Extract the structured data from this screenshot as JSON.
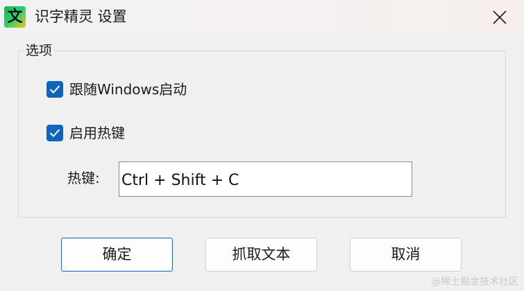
{
  "window": {
    "icon_glyph": "文",
    "title": "识字精灵 设置",
    "icon_colors": [
      "#19b35a",
      "#f3c51b"
    ]
  },
  "options": {
    "group_title": "选项",
    "start_with_windows": {
      "label": "跟随Windows启动",
      "checked": true
    },
    "enable_hotkey": {
      "label": "启用热键",
      "checked": true
    },
    "hotkey_label": "热键:",
    "hotkey_value": "Ctrl + Shift + C"
  },
  "buttons": {
    "ok": "确定",
    "capture": "抓取文本",
    "cancel": "取消"
  },
  "watermark": "@稀土掘金技术社区",
  "colors": {
    "accent": "#0f65bd",
    "background": "#f0f0f0"
  }
}
